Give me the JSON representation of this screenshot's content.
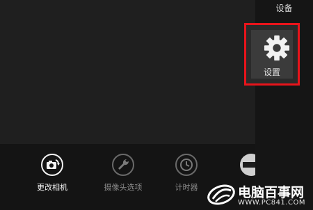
{
  "charms": {
    "title": "设备",
    "settings_label": "设置",
    "highlight_color": "#e8141b",
    "settings_icon": "gear-icon"
  },
  "appbar": {
    "commands": [
      {
        "label": "更改相机",
        "icon": "camera-switch-icon",
        "active": true
      },
      {
        "label": "摄像头选项",
        "icon": "wrench-icon",
        "active": false
      },
      {
        "label": "计时器",
        "icon": "clock-icon",
        "active": false
      }
    ],
    "partial_icon": "partial-round-icon"
  },
  "watermark": {
    "text": "电脑百事网",
    "url": "WWW.PC841.COM",
    "logo_icon": "swirl-logo-icon"
  }
}
